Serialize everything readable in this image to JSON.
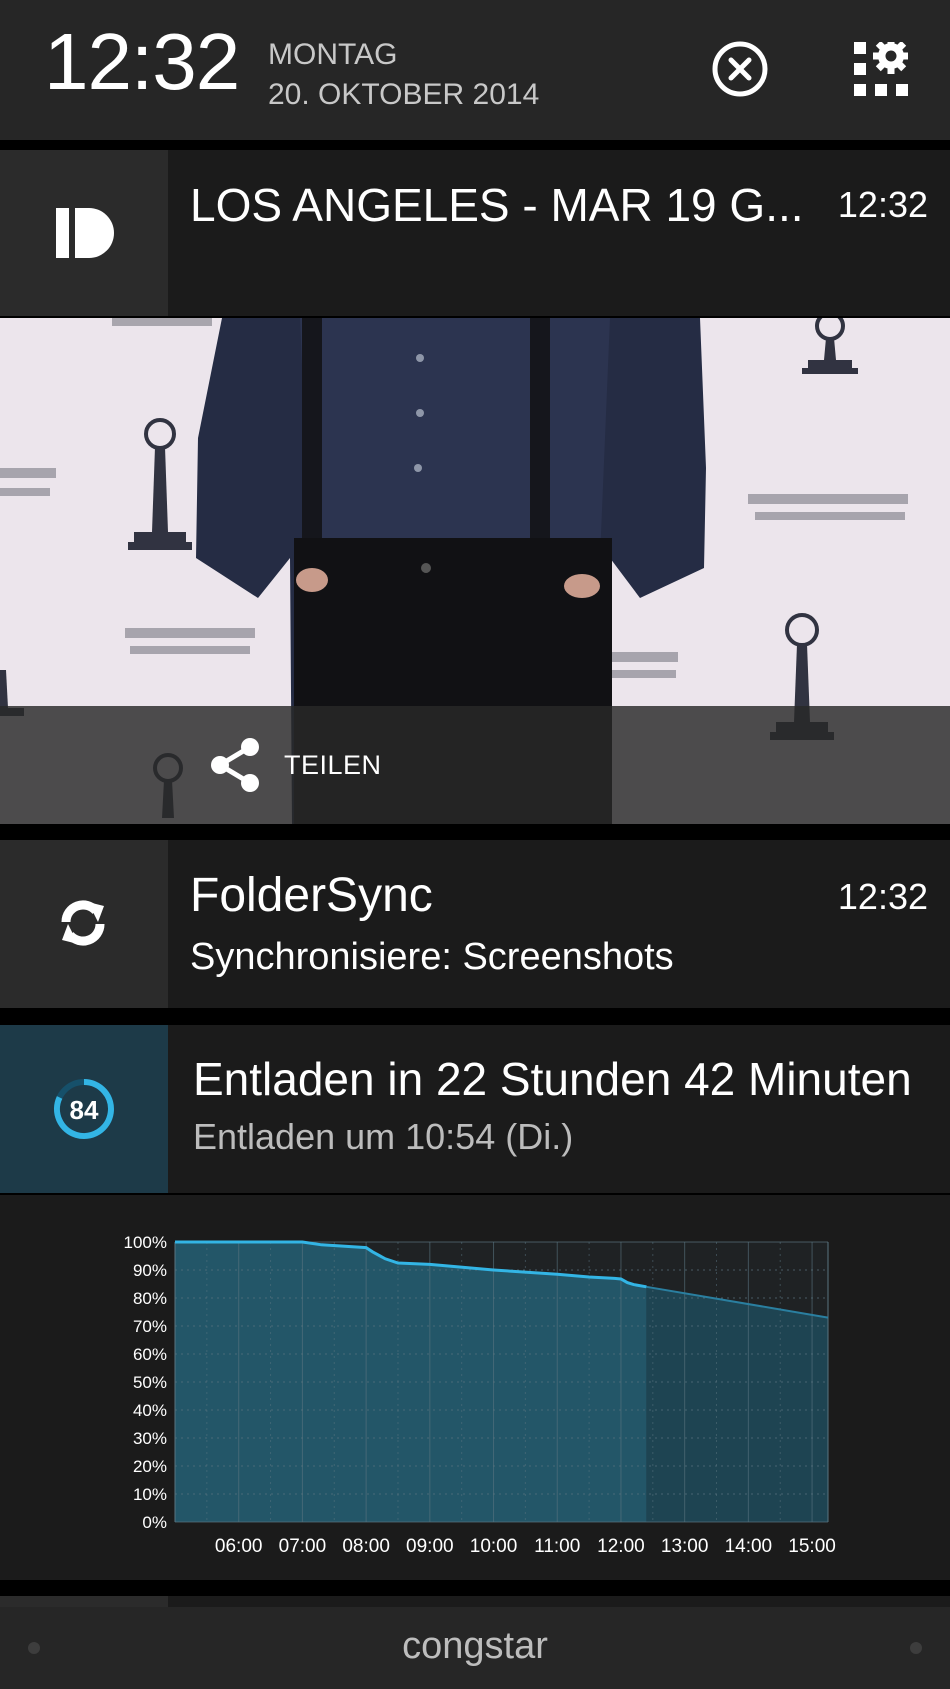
{
  "header": {
    "clock": "12:32",
    "weekday": "MONTAG",
    "date": "20. OKTOBER 2014",
    "clear_icon": "clear-all-icon",
    "settings_icon": "quick-settings-icon"
  },
  "notifications": [
    {
      "app": "Pushbullet",
      "icon": "pushbullet-icon",
      "title": "LOS ANGELES - MAR 19 G...",
      "time": "12:32",
      "action_label": "TEILEN",
      "action_icon": "share-icon"
    },
    {
      "app": "FolderSync",
      "icon": "sync-icon",
      "title": "FolderSync",
      "subtitle": "Synchronisiere: Screenshots",
      "time": "12:32"
    },
    {
      "app": "Battery",
      "icon": "battery-level-icon",
      "level": "84",
      "title": "Entladen in 22 Stunden 42 Minuten",
      "subtitle": "Entladen um 10:54 (Di.)"
    }
  ],
  "chart_data": {
    "type": "area",
    "y_ticks": [
      "100%",
      "90%",
      "80%",
      "70%",
      "60%",
      "50%",
      "40%",
      "30%",
      "20%",
      "10%",
      "0%"
    ],
    "x_ticks": [
      "06:00",
      "07:00",
      "08:00",
      "09:00",
      "10:00",
      "11:00",
      "12:00",
      "13:00",
      "14:00",
      "15:00"
    ],
    "ylim": [
      0,
      100
    ],
    "xlim": [
      5.0,
      15.25
    ],
    "x": [
      5.0,
      6.0,
      6.6,
      7.0,
      7.3,
      8.0,
      8.1,
      8.3,
      8.5,
      9.0,
      10.0,
      11.0,
      11.5,
      11.9,
      12.0,
      12.1,
      12.2,
      12.4
    ],
    "y": [
      100,
      100,
      100,
      100,
      99,
      98,
      96.5,
      94,
      92.5,
      92,
      90,
      88.5,
      87.5,
      87,
      86.8,
      85.5,
      84.8,
      84
    ],
    "projection_x": [
      12.4,
      15.25
    ],
    "projection_y": [
      84,
      73
    ],
    "colors": {
      "fill": "#235668",
      "line": "#33b5e5",
      "projection": "#1e4452",
      "grid": "#5a7480"
    }
  },
  "carrier": "congstar"
}
